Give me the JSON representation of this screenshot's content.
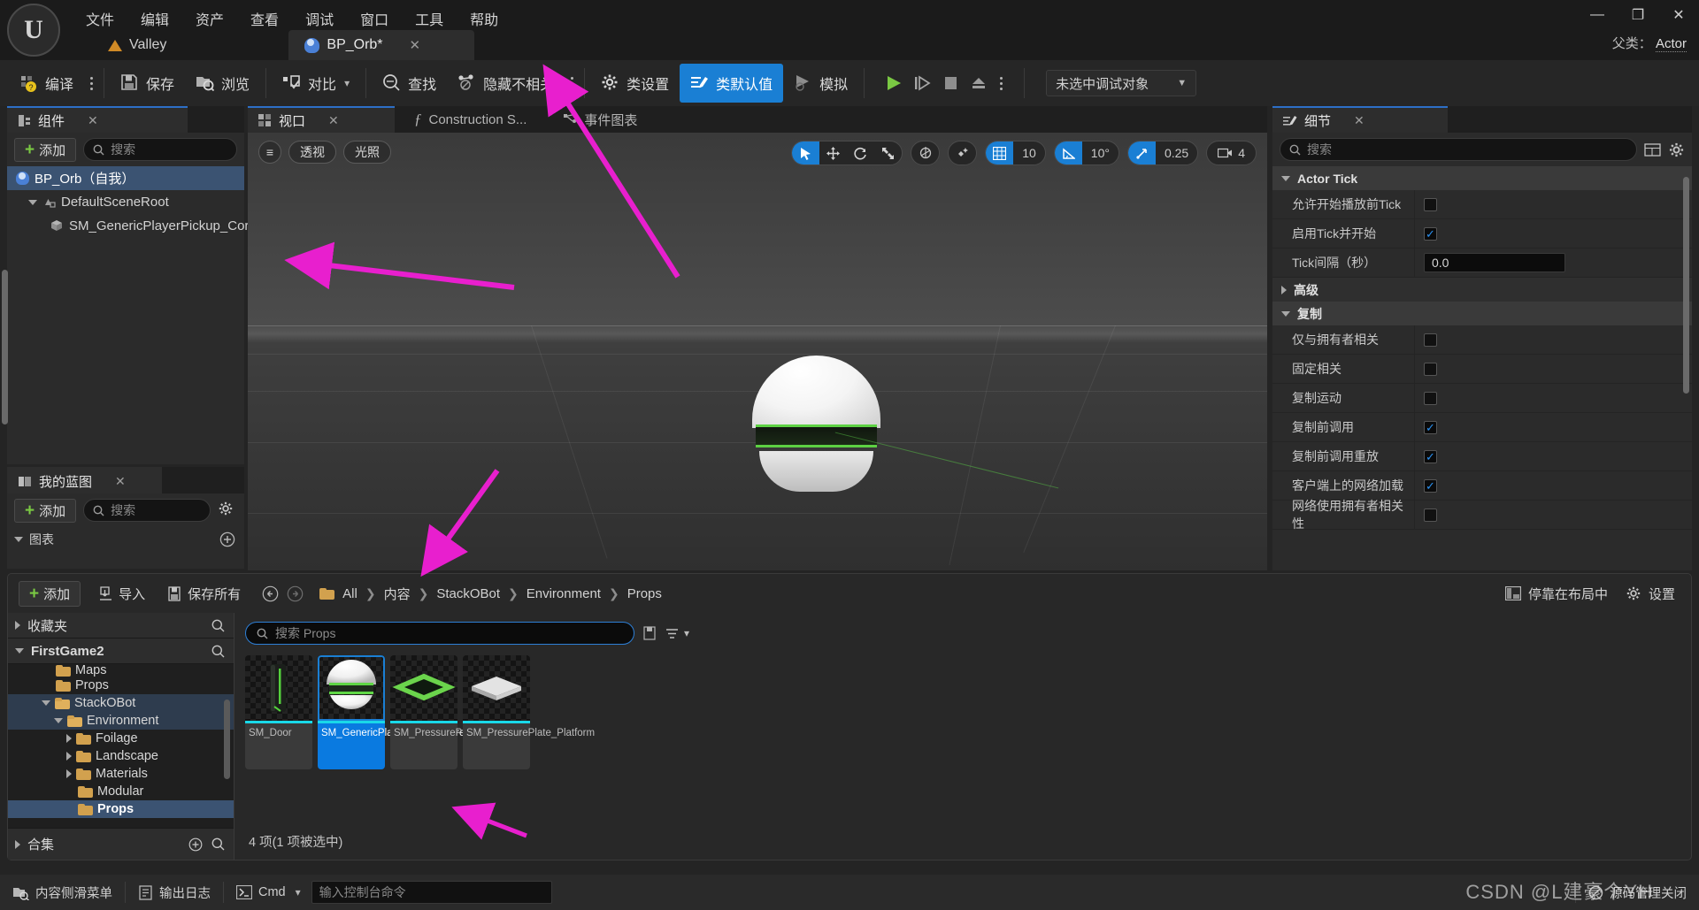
{
  "app": {
    "logo": "unreal-engine-logo",
    "parent_class_label": "父类：",
    "parent_class_value": "Actor"
  },
  "menubar": {
    "items": [
      "文件",
      "编辑",
      "资产",
      "查看",
      "调试",
      "窗口",
      "工具",
      "帮助"
    ]
  },
  "tabs": [
    {
      "label": "Valley",
      "icon": "level-icon",
      "active": false
    },
    {
      "label": "BP_Orb*",
      "icon": "blueprint-icon",
      "active": true,
      "close": "✕"
    }
  ],
  "window_controls": {
    "minimize": "—",
    "maximize": "❐",
    "close": "✕"
  },
  "toolbar": {
    "compile": "编译",
    "save": "保存",
    "browse": "浏览",
    "diff": "对比",
    "find": "查找",
    "hide_unrelated": "隐藏不相关",
    "class_settings": "类设置",
    "class_defaults": "类默认值",
    "simulate": "模拟",
    "debug_object": "未选中调试对象"
  },
  "components_panel": {
    "tab_label": "组件",
    "close": "✕",
    "add_label": "添加",
    "search_placeholder": "搜索",
    "tree": [
      {
        "label": "BP_Orb（自我）",
        "depth": 0,
        "selected": true,
        "icon": "blueprint-icon"
      },
      {
        "label": "DefaultSceneRoot",
        "depth": 1,
        "selected": false,
        "icon": "scene-root-icon"
      },
      {
        "label": "SM_GenericPlayerPickup_Core",
        "depth": 2,
        "selected": false,
        "icon": "static-mesh-icon"
      }
    ]
  },
  "myblueprint_panel": {
    "tab_label": "我的蓝图",
    "close": "✕",
    "add_label": "添加",
    "search_placeholder": "搜索",
    "section_label": "图表"
  },
  "viewport_panel": {
    "tabs": [
      {
        "label": "视口",
        "icon": "viewport-icon",
        "active": true,
        "close": "✕"
      },
      {
        "label": "Construction S...",
        "icon": "function-icon",
        "active": false
      },
      {
        "label": "事件图表",
        "icon": "event-graph-icon",
        "active": false
      }
    ],
    "view_menu": "≡",
    "perspective": "透视",
    "lighting": "光照",
    "tools": {
      "select": "select-tool",
      "move": "move-tool",
      "rotate": "rotate-tool",
      "scale": "scale-tool",
      "coordinate_system": "world-coordinate-icon",
      "surface_snap": "surface-snap-icon",
      "grid_snap_value": "10",
      "angle_snap_value": "10°",
      "scale_snap_value": "0.25",
      "camera_speed_value": "4"
    }
  },
  "details_panel": {
    "tab_label": "细节",
    "close": "✕",
    "search_placeholder": "搜索",
    "column_icon": "columns-icon",
    "settings_icon": "gear-icon",
    "categories": [
      {
        "name": "Actor Tick",
        "expanded": true,
        "rows": [
          {
            "label": "允许开始播放前Tick",
            "type": "checkbox",
            "checked": false
          },
          {
            "label": "启用Tick并开始",
            "type": "checkbox",
            "checked": true
          },
          {
            "label": "Tick间隔（秒）",
            "type": "number",
            "value": "0.0"
          }
        ]
      },
      {
        "name": "高级",
        "expanded": false,
        "rows": []
      },
      {
        "name": "复制",
        "expanded": true,
        "rows": [
          {
            "label": "仅与拥有者相关",
            "type": "checkbox",
            "checked": false
          },
          {
            "label": "固定相关",
            "type": "checkbox",
            "checked": false
          },
          {
            "label": "复制运动",
            "type": "checkbox",
            "checked": false
          },
          {
            "label": "复制前调用",
            "type": "checkbox",
            "checked": true
          },
          {
            "label": "复制前调用重放",
            "type": "checkbox",
            "checked": true
          },
          {
            "label": "客户端上的网络加载",
            "type": "checkbox",
            "checked": true
          },
          {
            "label": "网络使用拥有者相关性",
            "type": "checkbox",
            "checked": false
          }
        ]
      }
    ]
  },
  "content_browser": {
    "add_label": "添加",
    "import_label": "导入",
    "save_all_label": "保存所有",
    "back_icon": "back-arrow-icon",
    "forward_icon": "forward-arrow-icon",
    "breadcrumb": [
      "All",
      "内容",
      "StackOBot",
      "Environment",
      "Props"
    ],
    "dock_in_layout": "停靠在布局中",
    "settings": "设置",
    "search_placeholder": "搜索 Props",
    "tree": {
      "favorites_label": "收藏夹",
      "project_label": "FirstGame2",
      "collections_label": "合集",
      "items": [
        {
          "label": "Maps",
          "depth": 2,
          "state": "none",
          "selected": false,
          "clipped": true
        },
        {
          "label": "Props",
          "depth": 2,
          "state": "none",
          "selected": false
        },
        {
          "label": "StackOBot",
          "depth": 1,
          "state": "open",
          "highlight": true
        },
        {
          "label": "Environment",
          "depth": 2,
          "state": "open",
          "highlight": true
        },
        {
          "label": "Foilage",
          "depth": 3,
          "state": "closed"
        },
        {
          "label": "Landscape",
          "depth": 3,
          "state": "closed"
        },
        {
          "label": "Materials",
          "depth": 3,
          "state": "closed"
        },
        {
          "label": "Modular",
          "depth": 3,
          "state": "none"
        },
        {
          "label": "Props",
          "depth": 3,
          "state": "none",
          "selected": true
        }
      ]
    },
    "assets": [
      {
        "name": "SM_Door",
        "selected": false,
        "thumb": "door-thumb"
      },
      {
        "name": "SM_GenericPlayerPickup_Core",
        "selected": true,
        "thumb": "orb-thumb"
      },
      {
        "name": "SM_PressurePlate_Frame",
        "selected": false,
        "thumb": "frame-thumb"
      },
      {
        "name": "SM_PressurePlate_Platform",
        "selected": false,
        "thumb": "platform-thumb"
      }
    ],
    "status": "4 项(1 项被选中)"
  },
  "statusbar": {
    "content_drawer": "内容侧滑菜单",
    "output_log": "输出日志",
    "cmd_label": "Cmd",
    "cmd_placeholder": "输入控制台命令",
    "source_control": "源码管理关闭"
  },
  "watermark": "CSDN @L建豪个YH",
  "colors": {
    "accent_blue": "#1a7fd4",
    "selection_blue": "#3b5372",
    "green": "#7ac943",
    "annotation_pink": "#e81fce",
    "asset_strip": "#19d8e8"
  }
}
